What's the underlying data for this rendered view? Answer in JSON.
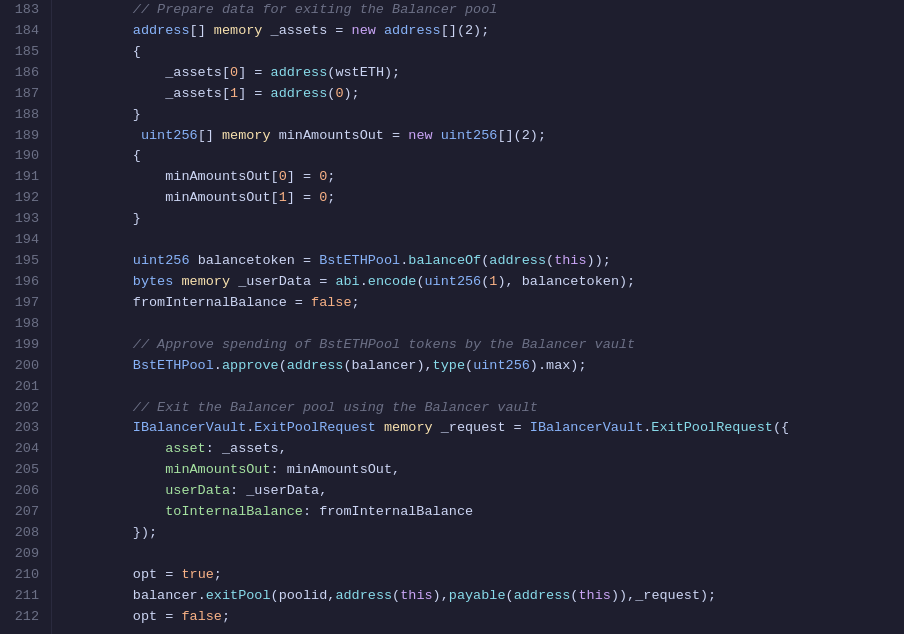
{
  "editor": {
    "background": "#1e1e2e",
    "lines": [
      {
        "num": 183,
        "tokens": [
          {
            "t": "comment",
            "v": "        // Prepare data for exiting the Balancer pool"
          }
        ]
      },
      {
        "num": 184,
        "tokens": [
          {
            "t": "type",
            "v": "        address"
          },
          {
            "t": "punct",
            "v": "[] "
          },
          {
            "t": "memory",
            "v": "memory"
          },
          {
            "t": "punct",
            "v": " _assets = "
          },
          {
            "t": "keyword",
            "v": "new"
          },
          {
            "t": "type",
            "v": " address"
          },
          {
            "t": "punct",
            "v": "[](2);"
          }
        ]
      },
      {
        "num": 185,
        "tokens": [
          {
            "t": "punct",
            "v": "        {"
          }
        ]
      },
      {
        "num": 186,
        "tokens": [
          {
            "t": "var",
            "v": "            _assets"
          },
          {
            "t": "punct",
            "v": "["
          },
          {
            "t": "number",
            "v": "0"
          },
          {
            "t": "punct",
            "v": "] = "
          },
          {
            "t": "func",
            "v": "address"
          },
          {
            "t": "punct",
            "v": "("
          },
          {
            "t": "var",
            "v": "wstETH"
          },
          {
            "t": "punct",
            "v": ");"
          }
        ]
      },
      {
        "num": 187,
        "tokens": [
          {
            "t": "var",
            "v": "            _assets"
          },
          {
            "t": "punct",
            "v": "["
          },
          {
            "t": "number",
            "v": "1"
          },
          {
            "t": "punct",
            "v": "] = "
          },
          {
            "t": "func",
            "v": "address"
          },
          {
            "t": "punct",
            "v": "("
          },
          {
            "t": "number",
            "v": "0"
          },
          {
            "t": "punct",
            "v": ");"
          }
        ]
      },
      {
        "num": 188,
        "tokens": [
          {
            "t": "punct",
            "v": "        }"
          }
        ]
      },
      {
        "num": 189,
        "tokens": [
          {
            "t": "type",
            "v": "         uint256"
          },
          {
            "t": "punct",
            "v": "[] "
          },
          {
            "t": "memory",
            "v": "memory"
          },
          {
            "t": "punct",
            "v": " minAmountsOut = "
          },
          {
            "t": "keyword",
            "v": "new"
          },
          {
            "t": "type",
            "v": " uint256"
          },
          {
            "t": "punct",
            "v": "[](2);"
          }
        ]
      },
      {
        "num": 190,
        "tokens": [
          {
            "t": "punct",
            "v": "        {"
          }
        ]
      },
      {
        "num": 191,
        "tokens": [
          {
            "t": "var",
            "v": "            minAmountsOut"
          },
          {
            "t": "punct",
            "v": "["
          },
          {
            "t": "number",
            "v": "0"
          },
          {
            "t": "punct",
            "v": "] = "
          },
          {
            "t": "number",
            "v": "0"
          },
          {
            "t": "punct",
            "v": ";"
          }
        ]
      },
      {
        "num": 192,
        "tokens": [
          {
            "t": "var",
            "v": "            minAmountsOut"
          },
          {
            "t": "punct",
            "v": "["
          },
          {
            "t": "number",
            "v": "1"
          },
          {
            "t": "punct",
            "v": "] = "
          },
          {
            "t": "number",
            "v": "0"
          },
          {
            "t": "punct",
            "v": ";"
          }
        ]
      },
      {
        "num": 193,
        "tokens": [
          {
            "t": "punct",
            "v": "        }"
          }
        ]
      },
      {
        "num": 194,
        "tokens": [
          {
            "t": "var",
            "v": ""
          }
        ]
      },
      {
        "num": 195,
        "tokens": [
          {
            "t": "type",
            "v": "        uint256"
          },
          {
            "t": "var",
            "v": " balancetoken = "
          },
          {
            "t": "type",
            "v": "BstETHPool"
          },
          {
            "t": "punct",
            "v": "."
          },
          {
            "t": "func",
            "v": "balanceOf"
          },
          {
            "t": "punct",
            "v": "("
          },
          {
            "t": "func",
            "v": "address"
          },
          {
            "t": "punct",
            "v": "("
          },
          {
            "t": "keyword",
            "v": "this"
          },
          {
            "t": "punct",
            "v": "));"
          }
        ]
      },
      {
        "num": 196,
        "tokens": [
          {
            "t": "type",
            "v": "        bytes"
          },
          {
            "t": "punct",
            "v": " "
          },
          {
            "t": "memory",
            "v": "memory"
          },
          {
            "t": "punct",
            "v": " _userData = "
          },
          {
            "t": "func",
            "v": "abi"
          },
          {
            "t": "punct",
            "v": "."
          },
          {
            "t": "func",
            "v": "encode"
          },
          {
            "t": "punct",
            "v": "("
          },
          {
            "t": "type",
            "v": "uint256"
          },
          {
            "t": "punct",
            "v": "("
          },
          {
            "t": "number",
            "v": "1"
          },
          {
            "t": "punct",
            "v": "), "
          },
          {
            "t": "var",
            "v": "balancetoken"
          },
          {
            "t": "punct",
            "v": ");"
          }
        ]
      },
      {
        "num": 197,
        "tokens": [
          {
            "t": "var",
            "v": "        fromInternalBalance"
          },
          {
            "t": "punct",
            "v": " = "
          },
          {
            "t": "bool",
            "v": "false"
          },
          {
            "t": "punct",
            "v": ";"
          }
        ]
      },
      {
        "num": 198,
        "tokens": [
          {
            "t": "var",
            "v": ""
          }
        ]
      },
      {
        "num": 199,
        "tokens": [
          {
            "t": "comment",
            "v": "        // Approve spending of BstETHPool tokens by the Balancer vault"
          }
        ]
      },
      {
        "num": 200,
        "tokens": [
          {
            "t": "type",
            "v": "        BstETHPool"
          },
          {
            "t": "punct",
            "v": "."
          },
          {
            "t": "func",
            "v": "approve"
          },
          {
            "t": "punct",
            "v": "("
          },
          {
            "t": "func",
            "v": "address"
          },
          {
            "t": "punct",
            "v": "("
          },
          {
            "t": "var",
            "v": "balancer"
          },
          {
            "t": "punct",
            "v": "),"
          },
          {
            "t": "func",
            "v": "type"
          },
          {
            "t": "punct",
            "v": "("
          },
          {
            "t": "type",
            "v": "uint256"
          },
          {
            "t": "punct",
            "v": ")."
          },
          {
            "t": "var",
            "v": "max"
          },
          {
            "t": "punct",
            "v": ");"
          }
        ]
      },
      {
        "num": 201,
        "tokens": [
          {
            "t": "var",
            "v": ""
          }
        ]
      },
      {
        "num": 202,
        "tokens": [
          {
            "t": "comment",
            "v": "        // Exit the Balancer pool using the Balancer vault"
          }
        ]
      },
      {
        "num": 203,
        "tokens": [
          {
            "t": "type",
            "v": "        IBalancerVault"
          },
          {
            "t": "punct",
            "v": "."
          },
          {
            "t": "type",
            "v": "ExitPoolRequest"
          },
          {
            "t": "punct",
            "v": " "
          },
          {
            "t": "memory",
            "v": "memory"
          },
          {
            "t": "punct",
            "v": " _request = "
          },
          {
            "t": "type",
            "v": "IBalancerVault"
          },
          {
            "t": "punct",
            "v": "."
          },
          {
            "t": "func",
            "v": "ExitPoolRequest"
          },
          {
            "t": "punct",
            "v": "({"
          }
        ]
      },
      {
        "num": 204,
        "tokens": [
          {
            "t": "field",
            "v": "            asset"
          },
          {
            "t": "punct",
            "v": ": "
          },
          {
            "t": "var",
            "v": "_assets"
          },
          {
            "t": "punct",
            "v": ","
          }
        ]
      },
      {
        "num": 205,
        "tokens": [
          {
            "t": "field",
            "v": "            minAmountsOut"
          },
          {
            "t": "punct",
            "v": ": "
          },
          {
            "t": "var",
            "v": "minAmountsOut"
          },
          {
            "t": "punct",
            "v": ","
          }
        ]
      },
      {
        "num": 206,
        "tokens": [
          {
            "t": "field",
            "v": "            userData"
          },
          {
            "t": "punct",
            "v": ": "
          },
          {
            "t": "var",
            "v": "_userData"
          },
          {
            "t": "punct",
            "v": ","
          }
        ]
      },
      {
        "num": 207,
        "tokens": [
          {
            "t": "field",
            "v": "            toInternalBalance"
          },
          {
            "t": "punct",
            "v": ": "
          },
          {
            "t": "var",
            "v": "fromInternalBalance"
          }
        ]
      },
      {
        "num": 208,
        "tokens": [
          {
            "t": "punct",
            "v": "        });"
          }
        ]
      },
      {
        "num": 209,
        "tokens": [
          {
            "t": "var",
            "v": ""
          }
        ]
      },
      {
        "num": 210,
        "tokens": [
          {
            "t": "var",
            "v": "        opt"
          },
          {
            "t": "punct",
            "v": " = "
          },
          {
            "t": "bool",
            "v": "true"
          },
          {
            "t": "punct",
            "v": ";"
          }
        ]
      },
      {
        "num": 211,
        "tokens": [
          {
            "t": "var",
            "v": "        balancer"
          },
          {
            "t": "punct",
            "v": "."
          },
          {
            "t": "func",
            "v": "exitPool"
          },
          {
            "t": "punct",
            "v": "("
          },
          {
            "t": "var",
            "v": "poolid"
          },
          {
            "t": "punct",
            "v": ","
          },
          {
            "t": "func",
            "v": "address"
          },
          {
            "t": "punct",
            "v": "("
          },
          {
            "t": "keyword",
            "v": "this"
          },
          {
            "t": "punct",
            "v": "),"
          },
          {
            "t": "func",
            "v": "payable"
          },
          {
            "t": "punct",
            "v": "("
          },
          {
            "t": "func",
            "v": "address"
          },
          {
            "t": "punct",
            "v": "("
          },
          {
            "t": "keyword",
            "v": "this"
          },
          {
            "t": "punct",
            "v": ")),"
          },
          {
            "t": "var",
            "v": "_request"
          },
          {
            "t": "punct",
            "v": ");"
          }
        ]
      },
      {
        "num": 212,
        "tokens": [
          {
            "t": "var",
            "v": "        opt"
          },
          {
            "t": "punct",
            "v": " = "
          },
          {
            "t": "bool",
            "v": "false"
          },
          {
            "t": "punct",
            "v": ";"
          }
        ]
      }
    ]
  }
}
